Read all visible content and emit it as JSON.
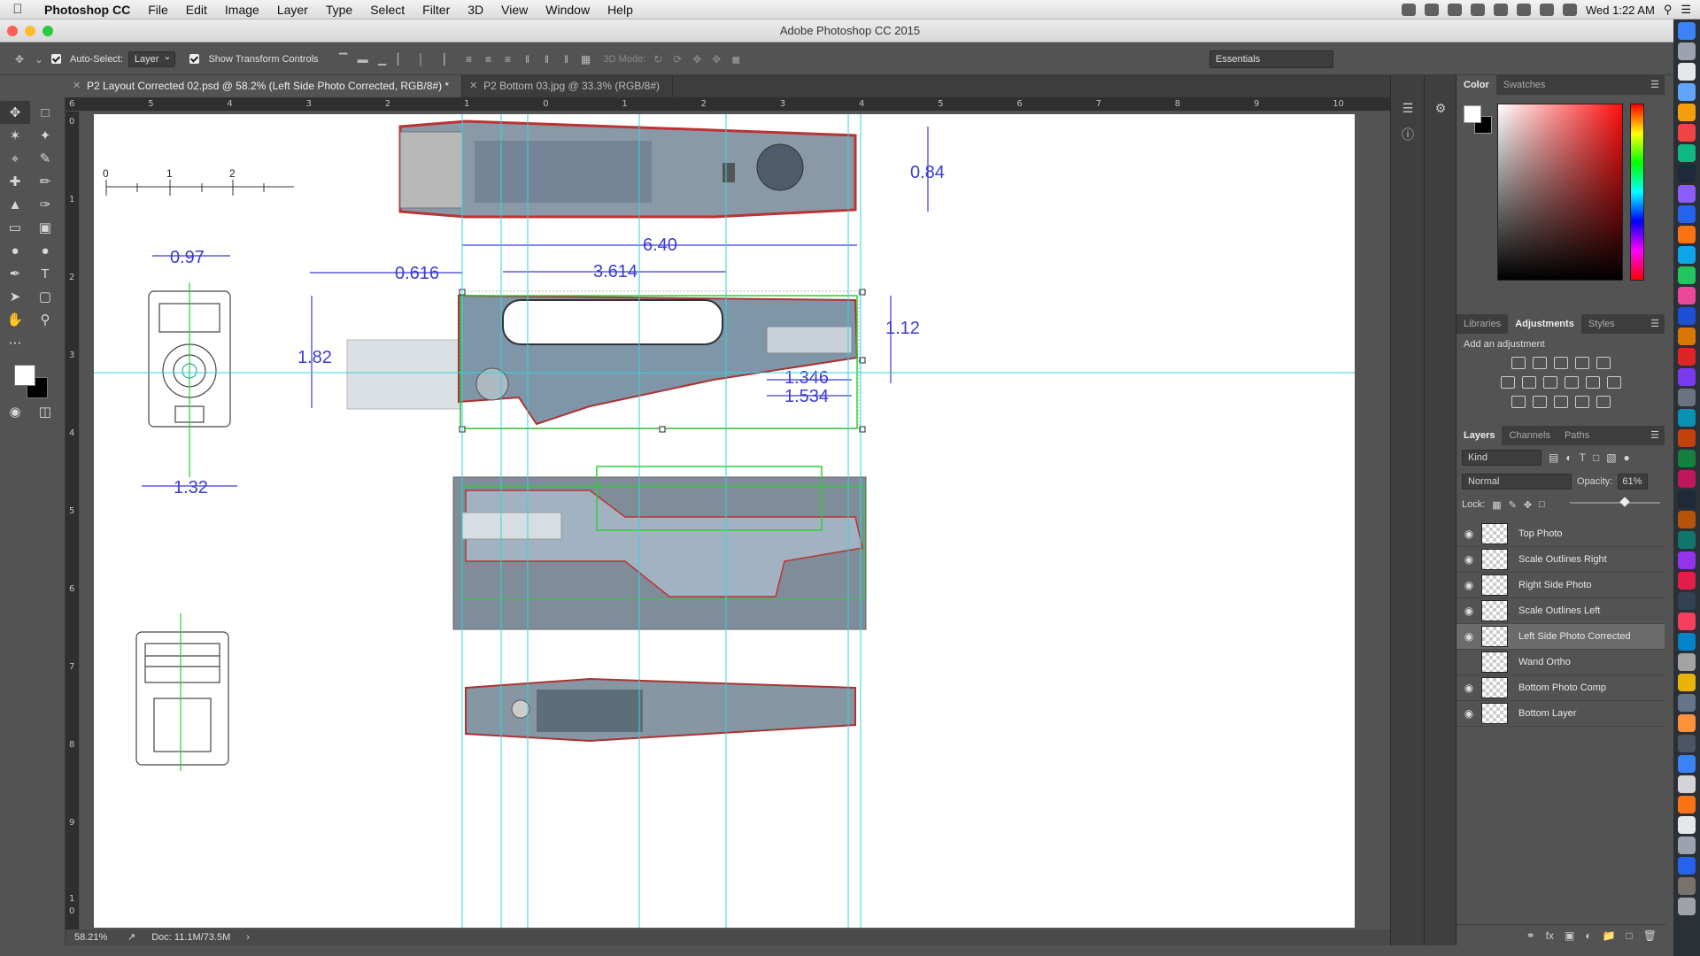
{
  "menubar": {
    "app_name": "Photoshop CC",
    "items": [
      "File",
      "Edit",
      "Image",
      "Layer",
      "Type",
      "Select",
      "Filter",
      "3D",
      "View",
      "Window",
      "Help"
    ],
    "clock": "Wed 1:22 AM"
  },
  "window": {
    "title": "Adobe Photoshop CC 2015"
  },
  "options": {
    "auto_select_label": "Auto-Select:",
    "auto_select_value": "Layer",
    "transform_label": "Show Transform Controls",
    "mode3d_label": "3D Mode:",
    "workspace": "Essentials"
  },
  "tabs": [
    {
      "label": "P2 Layout Corrected 02.psd @ 58.2% (Left Side Photo Corrected, RGB/8#) *"
    },
    {
      "label": "P2 Bottom 03.jpg @ 33.3% (RGB/8#)"
    }
  ],
  "rulers": {
    "top": [
      "6",
      "5",
      "4",
      "3",
      "2",
      "1",
      "0",
      "1",
      "2",
      "3",
      "4",
      "5",
      "6",
      "7",
      "8",
      "9",
      "10"
    ],
    "left": [
      "0",
      "1",
      "2",
      "3",
      "4",
      "5",
      "6",
      "7",
      "8",
      "9",
      "1",
      "0"
    ]
  },
  "status": {
    "zoom": "58.21%",
    "doc": "Doc: 11.1M/73.5M"
  },
  "panels": {
    "color_tabs": [
      "Color",
      "Swatches"
    ],
    "adj_tabs": [
      "Libraries",
      "Adjustments",
      "Styles"
    ],
    "adj_header": "Add an adjustment",
    "layer_tabs": [
      "Layers",
      "Channels",
      "Paths"
    ],
    "kind_label": "Kind",
    "blend_mode": "Normal",
    "opacity_label": "Opacity:",
    "opacity_value": "61%",
    "lock_label": "Lock:"
  },
  "layers": [
    {
      "name": "Top Photo",
      "visible": true
    },
    {
      "name": "Scale Outlines Right",
      "visible": true
    },
    {
      "name": "Right Side Photo",
      "visible": true
    },
    {
      "name": "Scale Outlines Left",
      "visible": true
    },
    {
      "name": "Left Side Photo Corrected",
      "visible": true,
      "selected": true
    },
    {
      "name": "Wand Ortho",
      "visible": false
    },
    {
      "name": "Bottom Photo Comp",
      "visible": true
    },
    {
      "name": "Bottom Layer",
      "visible": true
    }
  ],
  "drawing": {
    "scale_labels": [
      "0",
      "1",
      "2"
    ],
    "dims": [
      "0.84",
      "6.40",
      "0.616",
      "3.614",
      "1.12",
      "0.97",
      "1.82",
      "1.346",
      "1.534",
      "1.32"
    ]
  }
}
